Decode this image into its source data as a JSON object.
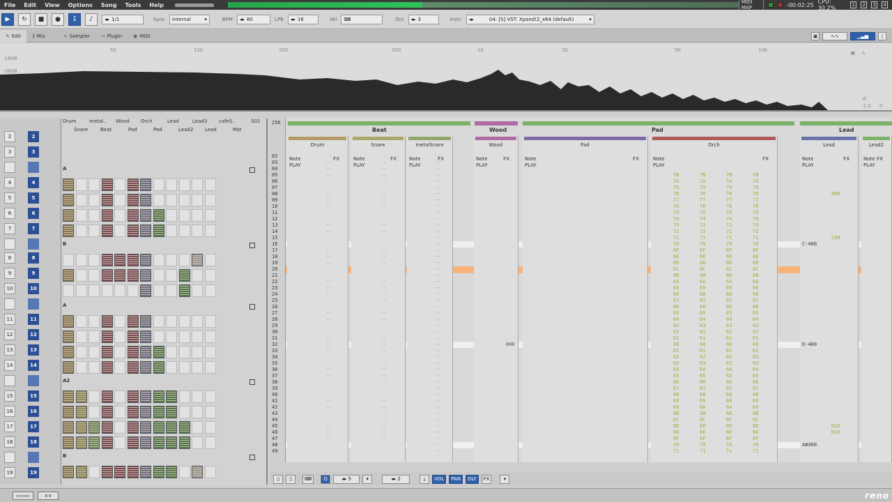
{
  "menu": [
    "File",
    "Edit",
    "View",
    "Options",
    "Song",
    "Tools",
    "Help"
  ],
  "status": {
    "midi_map": "MIDI MAP",
    "time": "-00:02:25",
    "cpu": "CPU: 30.2%",
    "layouts": [
      "1",
      "2",
      "3",
      "4"
    ]
  },
  "transport": {
    "pattern_pos": "1/1",
    "sync_label": "Sync",
    "sync_value": "Internal",
    "bpm_label": "BPM",
    "bpm": "80",
    "lpb_label": "LPB",
    "lpb": "16",
    "vel_label": "Vel",
    "oct_label": "Oct",
    "oct": "3",
    "instr_label": "Instr.",
    "instr_value": "04: [S] VST: Xpand!2_x64 (default)"
  },
  "tabs": [
    {
      "label": "Edit",
      "icon": "edit-icon"
    },
    {
      "label": "Mix",
      "icon": "mixer-icon"
    },
    {
      "label": "Sampler",
      "icon": "waveform-icon"
    },
    {
      "label": "Plugin",
      "icon": "plug-icon"
    },
    {
      "label": "MIDI",
      "icon": "midi-icon"
    }
  ],
  "spectrum": {
    "freq_labels": [
      "50",
      "100",
      "200",
      "500",
      "1K",
      "2K",
      "5K",
      "10K"
    ],
    "db_labels": [
      "-18dB",
      "-36dB"
    ],
    "right_labels": [
      "-L",
      "-R",
      "-1.0",
      "0"
    ]
  },
  "matrix": {
    "headers_top": [
      "Drum",
      "metal..",
      "Wood",
      "Orch",
      "Lead",
      "Lead3",
      "cafeS..",
      "S01"
    ],
    "headers_bottom": [
      "Snare",
      "Beat",
      "Pad",
      "Pad",
      "Lead2",
      "Lead",
      "Mst"
    ],
    "sections": [
      "A",
      "B",
      "A",
      "A2",
      "B"
    ]
  },
  "sequence": [
    {
      "pos": "2",
      "pat": "2"
    },
    {
      "pos": "3",
      "pat": "3"
    },
    {
      "pos": "",
      "pat": ""
    },
    {
      "pos": "4",
      "pat": "4"
    },
    {
      "pos": "5",
      "pat": "5"
    },
    {
      "pos": "6",
      "pat": "6"
    },
    {
      "pos": "7",
      "pat": "7"
    },
    {
      "pos": "",
      "pat": ""
    },
    {
      "pos": "8",
      "pat": "8"
    },
    {
      "pos": "9",
      "pat": "9"
    },
    {
      "pos": "10",
      "pat": "10"
    },
    {
      "pos": "",
      "pat": ""
    },
    {
      "pos": "11",
      "pat": "11"
    },
    {
      "pos": "12",
      "pat": "12"
    },
    {
      "pos": "13",
      "pat": "13"
    },
    {
      "pos": "14",
      "pat": "14"
    },
    {
      "pos": "",
      "pat": ""
    },
    {
      "pos": "15",
      "pat": "15"
    },
    {
      "pos": "16",
      "pat": "16"
    },
    {
      "pos": "17",
      "pat": "17"
    },
    {
      "pos": "18",
      "pat": "18"
    },
    {
      "pos": "",
      "pat": ""
    },
    {
      "pos": "19",
      "pat": "19"
    }
  ],
  "pattern": {
    "num_lines": "256",
    "groups": [
      {
        "name": "Beat",
        "color": "#7ab368"
      },
      {
        "name": "Wood",
        "color": "#b06aa4"
      },
      {
        "name": "Pad",
        "color": "#7ab368"
      },
      {
        "name": "Lead",
        "color": "#7ab368"
      }
    ],
    "tracks": [
      {
        "name": "Drum",
        "color": "#b59a67"
      },
      {
        "name": "Snare",
        "color": "#a8a86a"
      },
      {
        "name": "metalSnare",
        "color": "#8fa86a"
      },
      {
        "name": "Wood",
        "color": "#b06aa4"
      },
      {
        "name": "Pad",
        "color": "#7d6aa8"
      },
      {
        "name": "Orch",
        "color": "#b05a5a"
      },
      {
        "name": "Lead",
        "color": "#6a73a8"
      },
      {
        "name": "Lead2",
        "color": "#7ab368"
      }
    ],
    "col_note": "Note",
    "col_fx": "FX",
    "col_play": "PLAY",
    "line_numbers": [
      "02",
      "03",
      "04",
      "05",
      "06",
      "07",
      "08",
      "09",
      "10",
      "11",
      "12",
      "13",
      "14",
      "15",
      "16",
      "17",
      "18",
      "19",
      "20",
      "21",
      "22",
      "23",
      "24",
      "25",
      "26",
      "27",
      "28",
      "29",
      "30",
      "31",
      "32",
      "33",
      "34",
      "35",
      "36",
      "37",
      "38",
      "39",
      "40",
      "41",
      "42",
      "43",
      "44",
      "45",
      "46",
      "47",
      "48",
      "49"
    ],
    "orch_volumes": [
      "7B",
      "7A",
      "79",
      "78",
      "77",
      "76",
      "75",
      "74",
      "73",
      "72",
      "71",
      "70",
      "6F",
      "6E",
      "6D",
      "6C",
      "6B",
      "6A",
      "69",
      "68",
      "67",
      "66",
      "65",
      "64",
      "63",
      "62",
      "61",
      "60",
      "61",
      "62",
      "63",
      "64",
      "65",
      "66",
      "67",
      "68",
      "69",
      "6A",
      "6B",
      "6C",
      "6D",
      "6E",
      "6F",
      "70",
      "71"
    ],
    "lead_notes": {
      "l16": "C-400",
      "l32": "D-400",
      "l48": "A#300"
    },
    "lead_fx": {
      "l08": "800",
      "l15": "C00",
      "l45": "D10",
      "l46": "D10"
    },
    "wood_fx": {
      "l32": "800"
    }
  },
  "pattern_bottom": {
    "step": "5",
    "octave": "2",
    "buttons": [
      "VOL",
      "PAN",
      "DLY",
      "FX"
    ]
  },
  "footer": {
    "logo": "reno"
  }
}
